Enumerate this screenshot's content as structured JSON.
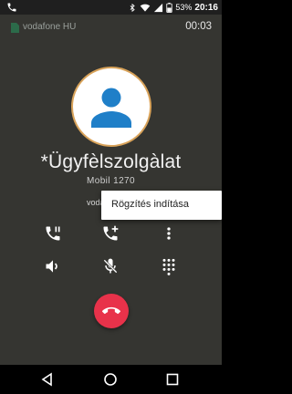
{
  "status_bar": {
    "battery_percent": "53%",
    "clock": "20:16",
    "icons": [
      "phone-icon",
      "bluetooth-icon",
      "wifi-icon",
      "signal-icon",
      "battery-icon"
    ]
  },
  "call": {
    "carrier": "vodafone HU",
    "timer": "00:03",
    "contact_name": "*Ügyfèlszolgàlat",
    "contact_sub": "Mobil  1270",
    "call_state": "voda"
  },
  "menu": {
    "items": [
      "Rögzítés indítása"
    ]
  },
  "controls": {
    "row1": [
      "hold-call-icon",
      "add-call-icon",
      "more-options-icon"
    ],
    "row2": [
      "speaker-icon",
      "mute-icon",
      "dialpad-icon"
    ],
    "end_call": "end-call-icon"
  },
  "colors": {
    "background": "#353531",
    "end_call": "#e8324a",
    "avatar_ring": "#d9a35a",
    "avatar_person": "#1f7fc8"
  },
  "nav": [
    "back-icon",
    "home-icon",
    "recents-icon"
  ]
}
